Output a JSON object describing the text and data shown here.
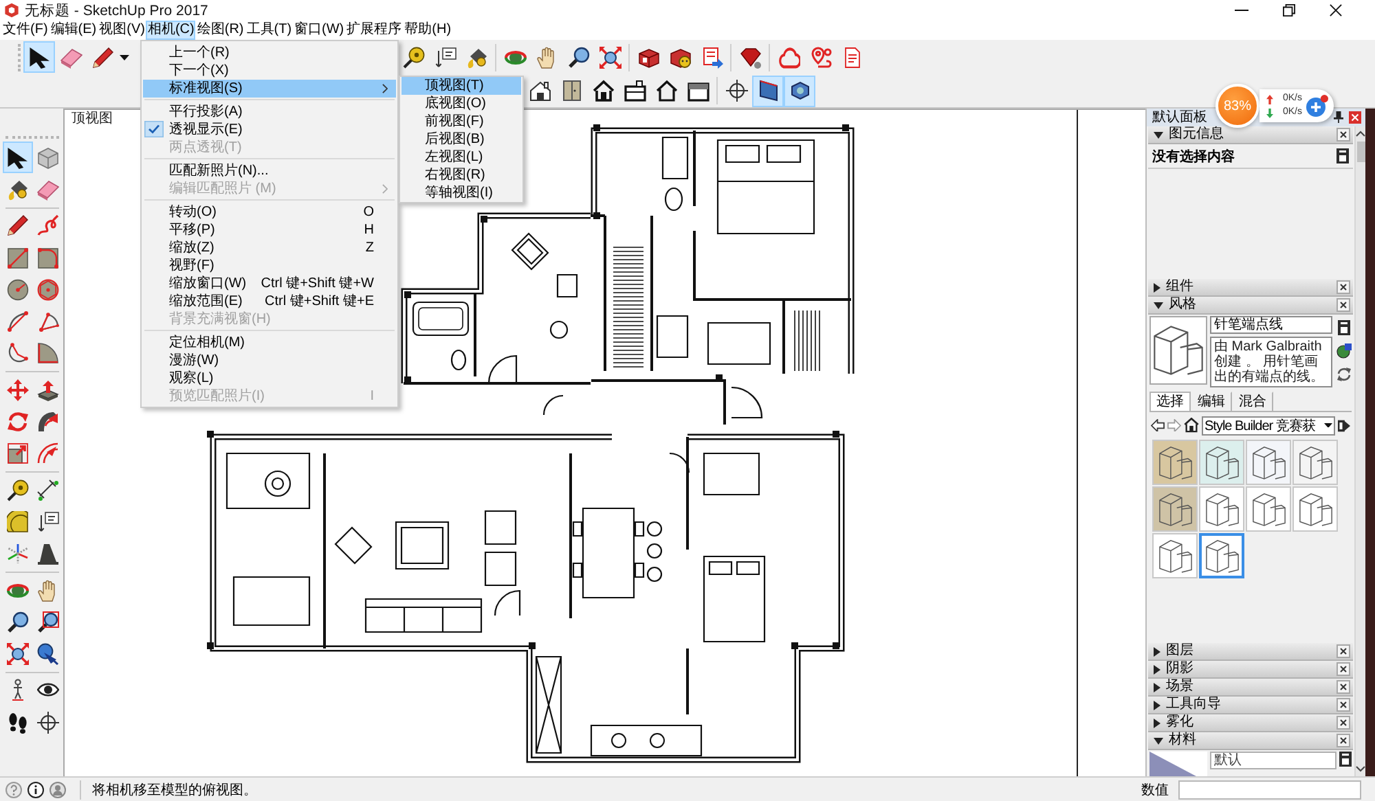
{
  "window": {
    "title": "无标题 - SketchUp Pro 2017"
  },
  "menu_bar": [
    {
      "label": "文件(F)",
      "selected": false
    },
    {
      "label": "编辑(E)",
      "selected": false
    },
    {
      "label": "视图(V)",
      "selected": false
    },
    {
      "label": "相机(C)",
      "selected": true
    },
    {
      "label": "绘图(R)",
      "selected": false
    },
    {
      "label": "工具(T)",
      "selected": false
    },
    {
      "label": "窗口(W)",
      "selected": false
    },
    {
      "label": "扩展程序",
      "selected": false
    },
    {
      "label": "帮助(H)",
      "selected": false
    }
  ],
  "camera_menu": {
    "items": [
      {
        "kind": "item",
        "label": "上一个(R)",
        "checked": false,
        "disabled": false,
        "submenu": false,
        "selected": false
      },
      {
        "kind": "item",
        "label": "下一个(X)",
        "checked": false,
        "disabled": false,
        "submenu": false,
        "selected": false
      },
      {
        "kind": "item",
        "label": "标准视图(S)",
        "checked": false,
        "disabled": false,
        "submenu": true,
        "selected": true
      },
      {
        "kind": "separator"
      },
      {
        "kind": "item",
        "label": "平行投影(A)",
        "checked": false,
        "disabled": false,
        "submenu": false,
        "selected": false
      },
      {
        "kind": "item",
        "label": "透视显示(E)",
        "checked": true,
        "disabled": false,
        "submenu": false,
        "selected": false
      },
      {
        "kind": "item",
        "label": "两点透视(T)",
        "checked": false,
        "disabled": true,
        "submenu": false,
        "selected": false
      },
      {
        "kind": "separator"
      },
      {
        "kind": "item",
        "label": "匹配新照片(N)...",
        "checked": false,
        "disabled": false,
        "submenu": false,
        "selected": false
      },
      {
        "kind": "item",
        "label": "编辑匹配照片 (M)",
        "checked": false,
        "disabled": true,
        "submenu": true,
        "selected": false
      },
      {
        "kind": "separator"
      },
      {
        "kind": "item",
        "label": "转动(O)",
        "shortcut": "O",
        "checked": false,
        "disabled": false,
        "submenu": false,
        "selected": false
      },
      {
        "kind": "item",
        "label": "平移(P)",
        "shortcut": "H",
        "checked": false,
        "disabled": false,
        "submenu": false,
        "selected": false
      },
      {
        "kind": "item",
        "label": "缩放(Z)",
        "shortcut": "Z",
        "checked": false,
        "disabled": false,
        "submenu": false,
        "selected": false
      },
      {
        "kind": "item",
        "label": "视野(F)",
        "checked": false,
        "disabled": false,
        "submenu": false,
        "selected": false
      },
      {
        "kind": "item",
        "label": "缩放窗口(W)",
        "shortcut": "Ctrl 键+Shift 键+W",
        "checked": false,
        "disabled": false,
        "submenu": false,
        "selected": false
      },
      {
        "kind": "item",
        "label": "缩放范围(E)",
        "shortcut": "Ctrl 键+Shift 键+E",
        "checked": false,
        "disabled": false,
        "submenu": false,
        "selected": false
      },
      {
        "kind": "item",
        "label": "背景充满视窗(H)",
        "checked": false,
        "disabled": true,
        "submenu": false,
        "selected": false
      },
      {
        "kind": "separator"
      },
      {
        "kind": "item",
        "label": "定位相机(M)",
        "checked": false,
        "disabled": false,
        "submenu": false,
        "selected": false
      },
      {
        "kind": "item",
        "label": "漫游(W)",
        "checked": false,
        "disabled": false,
        "submenu": false,
        "selected": false
      },
      {
        "kind": "item",
        "label": "观察(L)",
        "checked": false,
        "disabled": false,
        "submenu": false,
        "selected": false
      },
      {
        "kind": "item",
        "label": "预览匹配照片(I)",
        "shortcut": "I",
        "checked": false,
        "disabled": true,
        "submenu": false,
        "selected": false
      }
    ]
  },
  "standard_views_menu": {
    "items": [
      {
        "label": "顶视图(T)",
        "selected": true
      },
      {
        "label": "底视图(O)",
        "selected": false
      },
      {
        "label": "前视图(F)",
        "selected": false
      },
      {
        "label": "后视图(B)",
        "selected": false
      },
      {
        "label": "左视图(L)",
        "selected": false
      },
      {
        "label": "右视图(R)",
        "selected": false
      },
      {
        "label": "等轴视图(I)",
        "selected": false
      }
    ]
  },
  "toolbar_top": {
    "groups": [
      {
        "tools": [
          {
            "selected": true
          },
          {
            "selected": false
          },
          {
            "selected": false
          }
        ]
      },
      {
        "tools": [
          {
            "selected": false
          },
          {
            "selected": false
          },
          {
            "selected": false
          }
        ]
      },
      {
        "tools": [
          {
            "selected": false
          },
          {
            "selected": false
          },
          {
            "selected": false
          },
          {
            "selected": false
          }
        ]
      },
      {
        "tools": [
          {
            "selected": false
          },
          {
            "selected": false
          },
          {
            "selected": false
          }
        ]
      },
      {
        "tools": [
          {
            "selected": false
          }
        ]
      },
      {
        "tools": [
          {
            "selected": false
          },
          {
            "selected": false
          },
          {
            "selected": false
          }
        ]
      }
    ]
  },
  "toolbar_views": {
    "groups": [
      {
        "tools": [
          {
            "selected": false
          },
          {
            "selected": false
          },
          {
            "selected": false
          },
          {
            "selected": false
          },
          {
            "selected": false
          },
          {
            "selected": false
          }
        ]
      },
      {
        "tools": [
          {
            "selected": false
          },
          {
            "selected": true
          },
          {
            "selected": true
          }
        ]
      }
    ]
  },
  "left_toolbar": {
    "groups": [
      {
        "tools": [
          {
            "selected": true
          },
          {
            "selected": false
          },
          {
            "selected": false
          },
          {
            "selected": false
          }
        ]
      },
      {
        "tools": [
          {
            "selected": false
          },
          {
            "selected": false
          },
          {
            "selected": false
          },
          {
            "selected": false
          },
          {
            "selected": false
          },
          {
            "selected": false
          },
          {
            "selected": false
          },
          {
            "selected": false
          },
          {
            "selected": false
          },
          {
            "selected": false
          }
        ]
      },
      {
        "tools": [
          {
            "selected": false
          },
          {
            "selected": false
          },
          {
            "selected": false
          },
          {
            "selected": false
          },
          {
            "selected": false
          },
          {
            "selected": false
          }
        ]
      },
      {
        "tools": [
          {
            "selected": false
          },
          {
            "selected": false
          },
          {
            "selected": false
          },
          {
            "selected": false
          },
          {
            "selected": false
          },
          {
            "selected": false
          }
        ]
      },
      {
        "tools": [
          {
            "selected": false
          },
          {
            "selected": false
          },
          {
            "selected": false
          },
          {
            "selected": false
          },
          {
            "selected": false
          },
          {
            "selected": false
          }
        ]
      },
      {
        "tools": [
          {
            "selected": false
          },
          {
            "selected": false
          },
          {
            "selected": false
          },
          {
            "selected": false
          }
        ]
      }
    ]
  },
  "viewport": {
    "label": "顶视图"
  },
  "speed_widget": {
    "percent": "83%",
    "upload": "0K/s",
    "download": "0K/s"
  },
  "tray": {
    "title": "默认面板",
    "panels": [
      {
        "kind": "entity_info",
        "title": "图元信息",
        "expanded": true,
        "message": "没有选择内容"
      },
      {
        "title": "组件",
        "expanded": false
      },
      {
        "kind": "styles",
        "title": "风格",
        "expanded": true,
        "style_name": "针笔端点线",
        "description": "由 Mark Galbraith 创建 。 用针笔画出的有端点的线。",
        "tabs": [
          {
            "label": "选择",
            "selected": true
          },
          {
            "label": "编辑",
            "selected": false
          },
          {
            "label": "混合",
            "selected": false
          }
        ],
        "library": "Style Builder 竞赛获",
        "thumbnails": [
          {
            "color": "#d8c7a0",
            "selected": false
          },
          {
            "color": "#dcefed",
            "selected": false
          },
          {
            "color": "#f3f5f9",
            "selected": false
          },
          {
            "color": "#f4f4f4",
            "selected": false
          },
          {
            "color": "#cfc3a6",
            "selected": false
          },
          {
            "color": "#ffffff",
            "selected": false
          },
          {
            "color": "#ffffff",
            "selected": false
          },
          {
            "color": "#ffffff",
            "selected": false
          },
          {
            "color": "#ffffff",
            "selected": false
          },
          {
            "color": "#ffffff",
            "selected": true
          }
        ]
      },
      {
        "title": "图层",
        "expanded": false
      },
      {
        "title": "阴影",
        "expanded": false
      },
      {
        "title": "场景",
        "expanded": false
      },
      {
        "title": "工具向导",
        "expanded": false
      },
      {
        "title": "雾化",
        "expanded": false
      },
      {
        "kind": "materials",
        "title": "材料",
        "expanded": true,
        "material_name": "默认"
      }
    ]
  },
  "status_bar": {
    "hint": "将相机移至模型的俯视图。",
    "value_label": "数值"
  }
}
